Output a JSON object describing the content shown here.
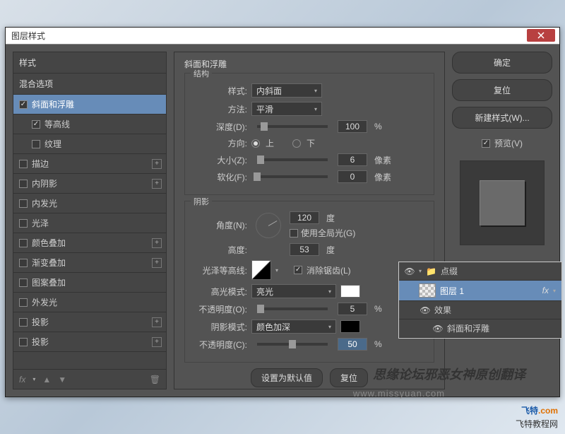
{
  "window": {
    "title": "图层样式"
  },
  "buttons": {
    "ok": "确定",
    "cancel": "复位",
    "new_style": "新建样式(W)...",
    "preview": "预览(V)",
    "defaults": "设置为默认值",
    "reset": "复位"
  },
  "left": {
    "header": "样式",
    "blend": "混合选项",
    "items": [
      {
        "label": "斜面和浮雕",
        "checked": true,
        "active": true
      },
      {
        "label": "等高线",
        "checked": true,
        "indent": true
      },
      {
        "label": "纹理",
        "checked": false,
        "indent": true
      },
      {
        "label": "描边",
        "checked": false,
        "add": true
      },
      {
        "label": "内阴影",
        "checked": false,
        "add": true
      },
      {
        "label": "内发光",
        "checked": false
      },
      {
        "label": "光泽",
        "checked": false
      },
      {
        "label": "颜色叠加",
        "checked": false,
        "add": true
      },
      {
        "label": "渐变叠加",
        "checked": false,
        "add": true
      },
      {
        "label": "图案叠加",
        "checked": false
      },
      {
        "label": "外发光",
        "checked": false
      },
      {
        "label": "投影",
        "checked": false,
        "add": true
      },
      {
        "label": "投影",
        "checked": false,
        "add": true
      }
    ],
    "footer_fx": "fx"
  },
  "center": {
    "title": "斜面和浮雕",
    "structure": {
      "label": "结构",
      "style_label": "样式:",
      "style_value": "内斜面",
      "technique_label": "方法:",
      "technique_value": "平滑",
      "depth_label": "深度(D):",
      "depth_value": "100",
      "depth_unit": "%",
      "direction_label": "方向:",
      "dir_up": "上",
      "dir_down": "下",
      "size_label": "大小(Z):",
      "size_value": "6",
      "size_unit": "像素",
      "soften_label": "软化(F):",
      "soften_value": "0",
      "soften_unit": "像素"
    },
    "shading": {
      "label": "阴影",
      "angle_label": "角度(N):",
      "angle_value": "120",
      "angle_unit": "度",
      "global_light": "使用全局光(G)",
      "altitude_label": "高度:",
      "altitude_value": "53",
      "altitude_unit": "度",
      "gloss_label": "光泽等高线:",
      "antialias": "消除锯齿(L)",
      "highlight_mode_label": "高光模式:",
      "highlight_mode_value": "亮光",
      "opacity1_label": "不透明度(O):",
      "opacity1_value": "5",
      "opacity1_unit": "%",
      "shadow_mode_label": "阴影模式:",
      "shadow_mode_value": "颜色加深",
      "opacity2_label": "不透明度(C):",
      "opacity2_value": "50",
      "opacity2_unit": "%"
    }
  },
  "layers": {
    "group": "点缀",
    "layer_name": "图层 1",
    "fx": "fx",
    "effects": "效果",
    "effect1": "斜面和浮雕"
  },
  "watermark": {
    "text1": "思缘论坛邪恶女神原创翻译",
    "url": "www.missyuan.com",
    "site1a": "飞特",
    "site1b": ".com",
    "site2": "飞特教程网"
  }
}
